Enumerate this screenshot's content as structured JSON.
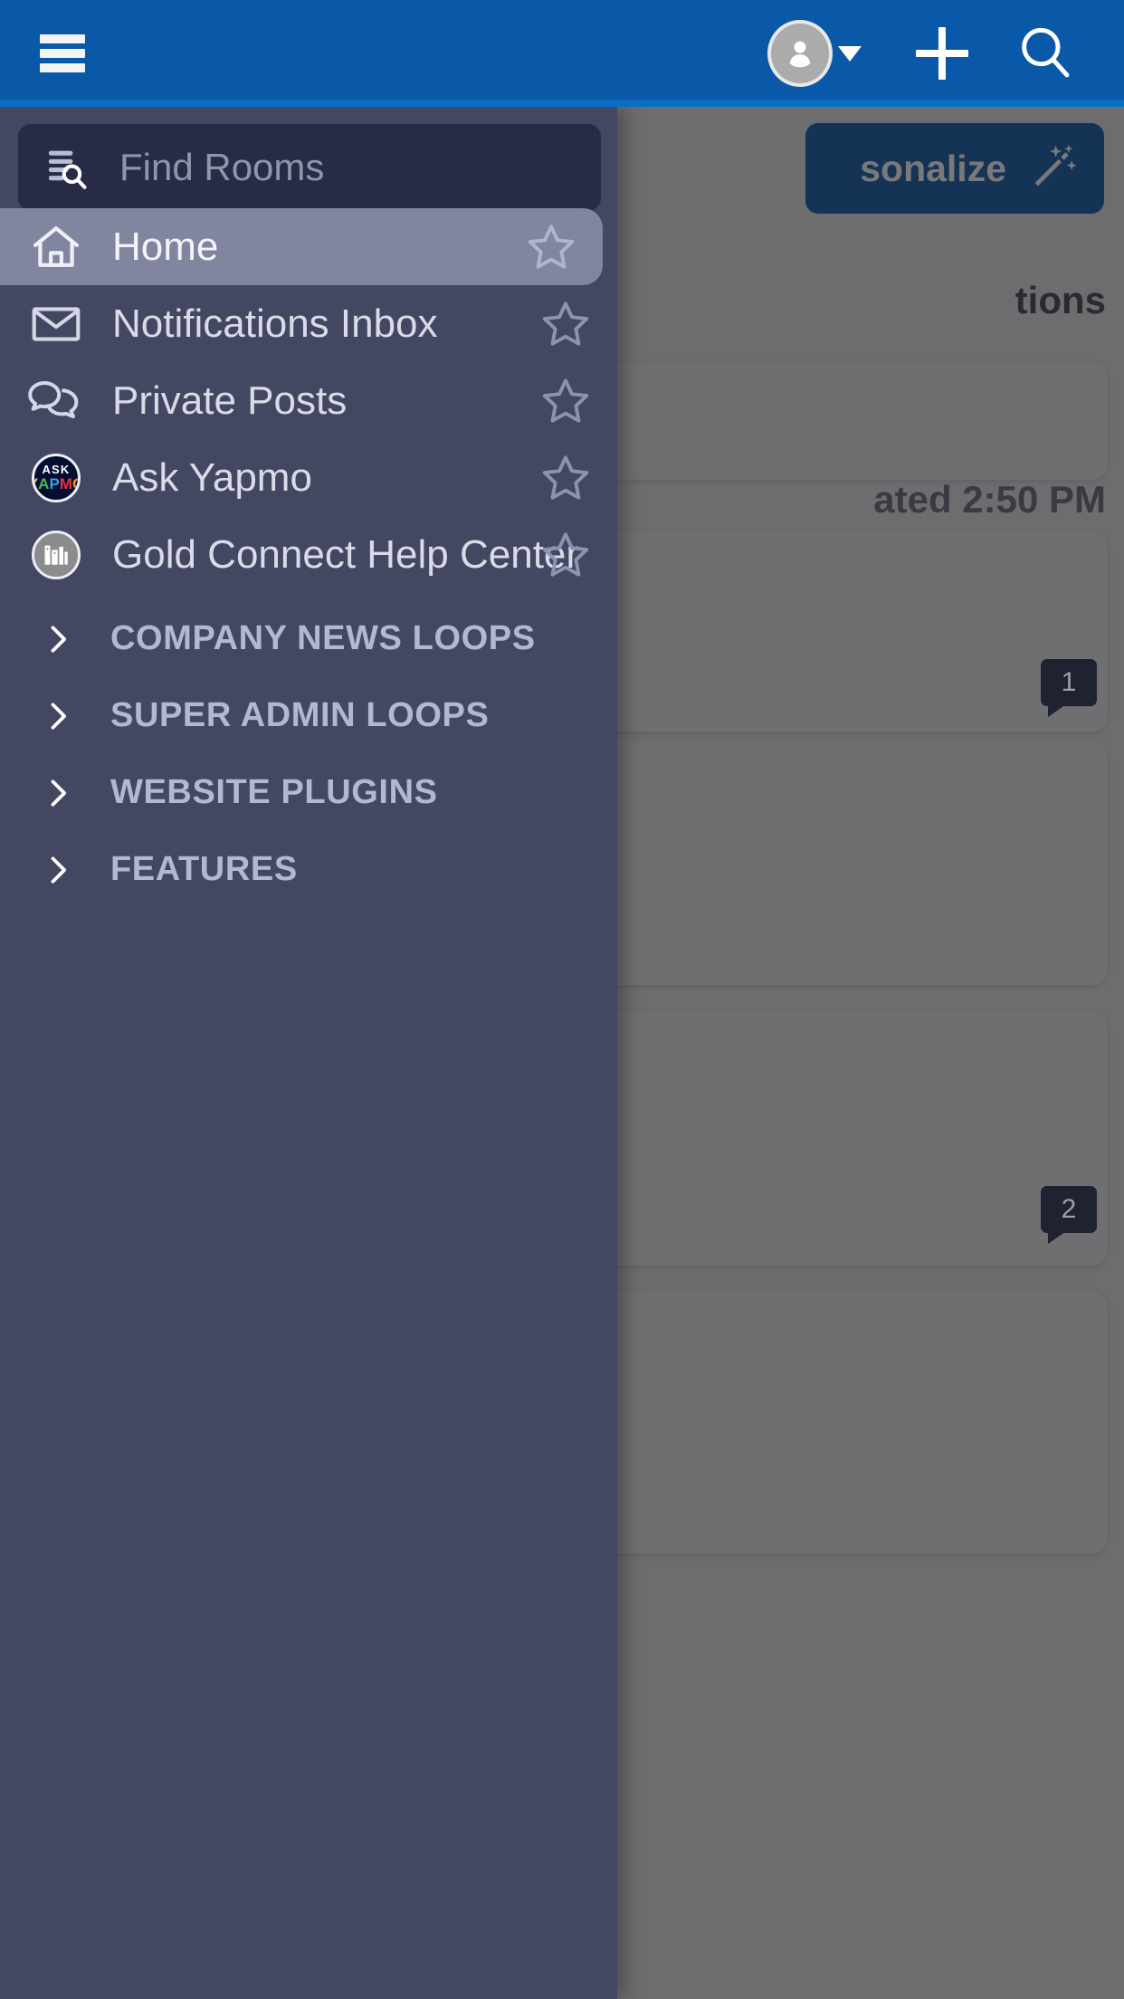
{
  "appbar": {
    "menu_icon": "hamburger-icon",
    "avatar_icon": "user-avatar-icon",
    "dropdown_icon": "chevron-down-icon",
    "add_icon": "plus-icon",
    "search_icon": "search-icon",
    "background_color": "#0a58a8"
  },
  "drawer": {
    "search": {
      "placeholder": "Find Rooms",
      "icon": "find-rooms-icon",
      "value": ""
    },
    "items": [
      {
        "label": "Home",
        "icon": "home-icon",
        "active": true,
        "favorite_icon": "star-outline-icon"
      },
      {
        "label": "Notifications Inbox",
        "icon": "envelope-icon",
        "active": false,
        "favorite_icon": "star-outline-icon"
      },
      {
        "label": "Private Posts",
        "icon": "chat-bubbles-icon",
        "active": false,
        "favorite_icon": "star-outline-icon"
      },
      {
        "label": "Ask Yapmo",
        "icon": "ask-yapmo-logo",
        "active": false,
        "favorite_icon": "star-outline-icon"
      },
      {
        "label": "Gold Connect Help Center",
        "icon": "help-center-logo",
        "active": false,
        "favorite_icon": "star-outline-icon"
      }
    ],
    "sections": [
      {
        "label": "COMPANY NEWS LOOPS",
        "icon": "chevron-right-icon",
        "expanded": false
      },
      {
        "label": "SUPER ADMIN LOOPS",
        "icon": "chevron-right-icon",
        "expanded": false
      },
      {
        "label": "WEBSITE PLUGINS",
        "icon": "chevron-right-icon",
        "expanded": false
      },
      {
        "label": "FEATURES",
        "icon": "chevron-right-icon",
        "expanded": false
      }
    ],
    "ask_yapmo_logo": {
      "top_text": "ASK",
      "letters": [
        {
          "char": "Y",
          "color": "#f2c72e"
        },
        {
          "char": "A",
          "color": "#3fbf4f"
        },
        {
          "char": "P",
          "color": "#2ea7e0"
        },
        {
          "char": "M",
          "color": "#e8333c"
        },
        {
          "char": "O",
          "color": "#f59b1f"
        }
      ]
    },
    "background_color": "#434761"
  },
  "background_page": {
    "personalize_button": {
      "label": "sonalize",
      "icon": "magic-wand-icon",
      "color": "#0d3a66"
    },
    "section_title": "tions",
    "updated_text": "ated 2:50 PM",
    "comment_badges": [
      {
        "count": "1"
      },
      {
        "count": "2"
      }
    ]
  }
}
